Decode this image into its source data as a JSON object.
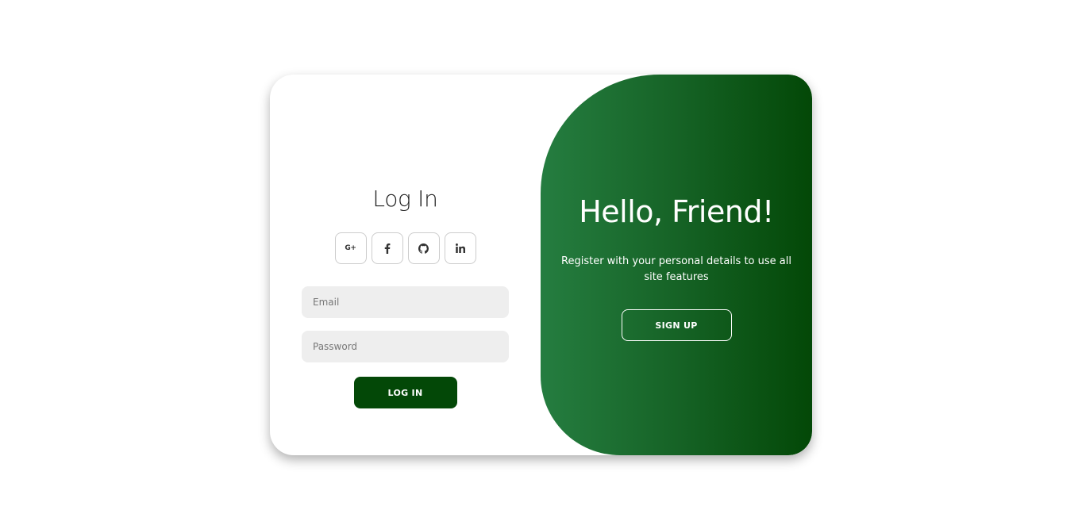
{
  "login": {
    "title": "Log In",
    "social": [
      {
        "icon": "google-plus-icon",
        "label": "G+"
      },
      {
        "icon": "facebook-icon"
      },
      {
        "icon": "github-icon"
      },
      {
        "icon": "linkedin-icon"
      }
    ],
    "email_placeholder": "Email",
    "password_placeholder": "Password",
    "button_label": "LOG IN"
  },
  "welcome": {
    "title": "Hello, Friend!",
    "text": "Register with your personal details to use all site features",
    "button_label": "SIGN UP"
  },
  "colors": {
    "primary": "#034807",
    "gradient_start": "#257d40",
    "gradient_end": "#034807",
    "input_bg": "#eeeeee"
  }
}
